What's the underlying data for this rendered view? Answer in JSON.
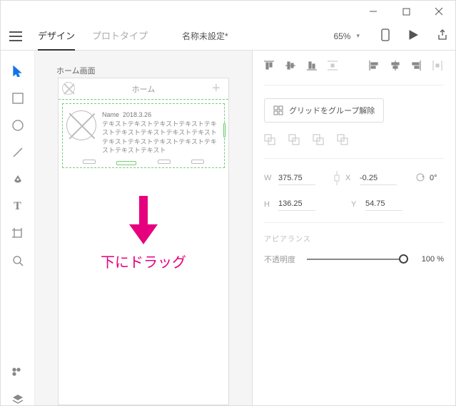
{
  "window": {
    "minimize": "–",
    "maximize": "☐",
    "close": "✕"
  },
  "header": {
    "tabs": {
      "design": "デザイン",
      "prototype": "プロトタイプ"
    },
    "doc_title": "名称未設定*",
    "zoom": "65%",
    "icons": {
      "device": "device",
      "play": "play",
      "share": "share"
    }
  },
  "tools": {
    "select": "select",
    "rect": "rectangle",
    "ellipse": "ellipse",
    "line": "line",
    "pen": "pen",
    "text": "T",
    "artboard": "artboard",
    "zoom": "zoom",
    "assets": "assets",
    "layers": "layers"
  },
  "canvas": {
    "artboard_name": "ホーム画面",
    "title": "ホーム",
    "card": {
      "name": "Name",
      "date": "2018.3.26",
      "body": "テキストテキストテキストテキストテキストテキストテキストテキストテキストテキストテキストテキストテキストテキストテキストテキスト"
    },
    "hint": "下にドラッグ"
  },
  "panel": {
    "repeat_grid_btn": "グリッドをグループ解除",
    "dims": {
      "w_label": "W",
      "w": "375.75",
      "h_label": "H",
      "h": "136.25",
      "x_label": "X",
      "x": "-0.25",
      "y_label": "Y",
      "y": "54.75",
      "rot": "0°"
    },
    "appearance_title": "アピアランス",
    "opacity_label": "不透明度",
    "opacity_value": "100 %"
  }
}
